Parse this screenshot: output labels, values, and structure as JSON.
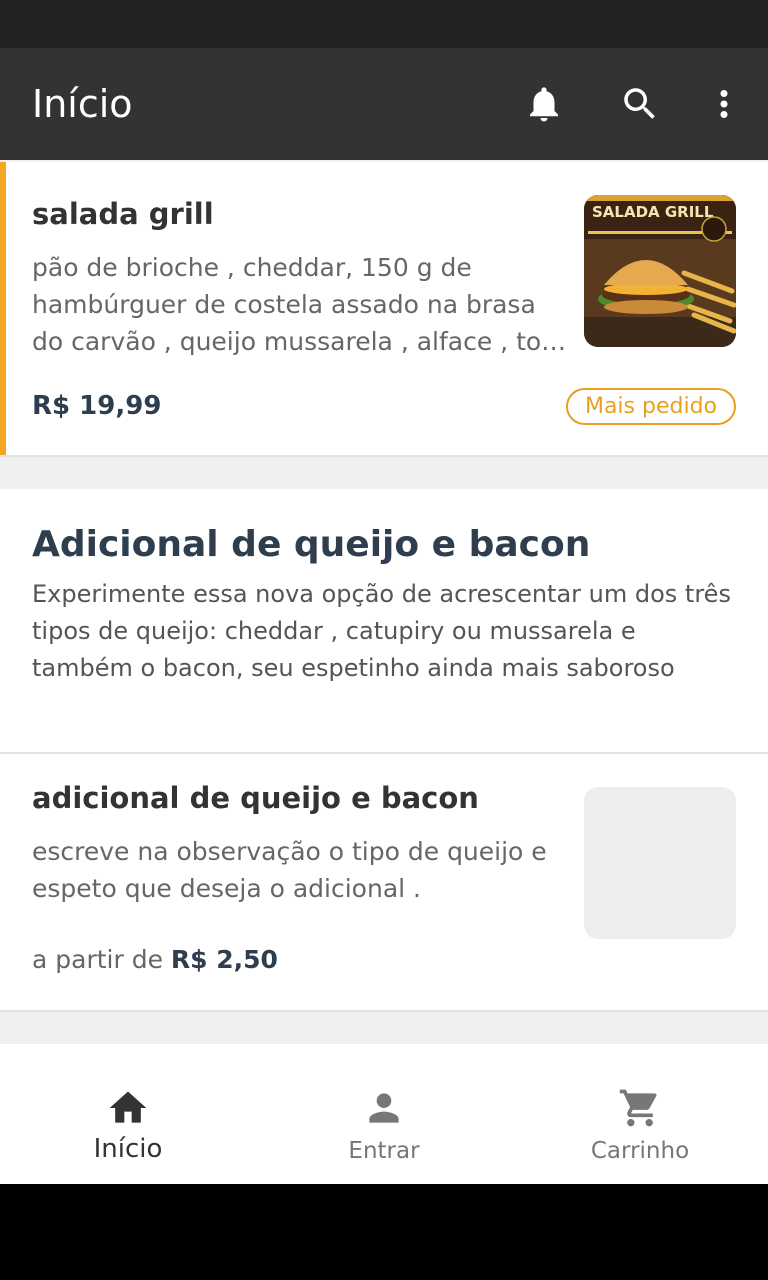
{
  "app_bar": {
    "title": "Início",
    "icons": [
      "bell-icon",
      "search-icon",
      "more-vert-icon"
    ]
  },
  "featured_item": {
    "title": "salada grill",
    "description_lines": [
      "pão de brioche , cheddar, 150 g de",
      "hambúrguer de costela assado na brasa",
      "do carvão , queijo mussarela , alface , tomate"
    ],
    "price": "R$ 19,99",
    "badge": "Mais pedido",
    "image_text": "SALADA GRILL"
  },
  "section": {
    "title": "Adicional de queijo e bacon",
    "description": "Experimente essa nova opção de acrescentar um dos três tipos de queijo: cheddar , catupiry ou mussarela e  também o bacon, seu espetinho ainda mais saboroso"
  },
  "item_2": {
    "title": "adicional de queijo e bacon",
    "description": "escreve na observação o tipo de queijo e espeto que deseja o adicional .",
    "price_prefix": "a partir de ",
    "price": "R$ 2,50"
  },
  "bottom_nav": {
    "home": "Início",
    "login": "Entrar",
    "cart": "Carrinho"
  },
  "colors": {
    "app_bar": "#333333",
    "accent": "#f5a623",
    "badge": "#e8a020",
    "price": "#2e3e4e"
  }
}
